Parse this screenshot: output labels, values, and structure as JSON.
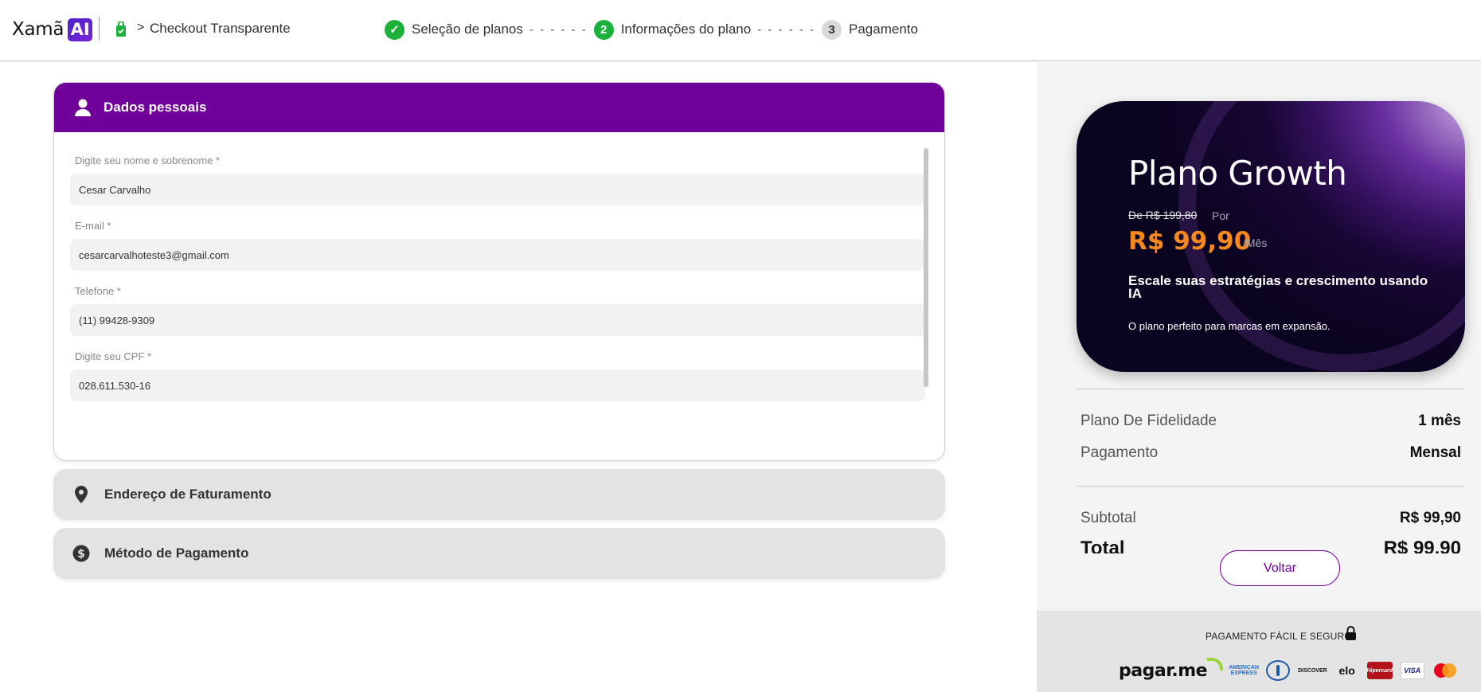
{
  "header": {
    "logo_text": "Xamã",
    "logo_badge": "AI",
    "breadcrumb_title": "Checkout Transparente",
    "steps": [
      {
        "number": "✓",
        "label": "Seleção de planos",
        "state": "done"
      },
      {
        "number": "2",
        "label": "Informações do plano",
        "state": "active"
      },
      {
        "number": "3",
        "label": "Pagamento",
        "state": "todo"
      }
    ],
    "step_separator": "- - - - - -"
  },
  "personal": {
    "title": "Dados pessoais",
    "fields": [
      {
        "label": "Digite seu nome e sobrenome *",
        "value": "Cesar Carvalho"
      },
      {
        "label": "E-mail *",
        "value": "cesarcarvalhoteste3@gmail.com"
      },
      {
        "label": "Telefone *",
        "value": "(11) 99428-9309"
      },
      {
        "label": "Digite seu CPF *",
        "value": "028.611.530-16"
      }
    ]
  },
  "billing": {
    "title": "Endereço de Faturamento"
  },
  "payment_method": {
    "title": "Método de Pagamento"
  },
  "plan": {
    "name": "Plano Growth",
    "old_price": "De R$ 199,80",
    "por": "Por",
    "price": "R$ 99,90",
    "period": "/Mês",
    "tagline": "Escale suas estratégias e crescimento usando IA",
    "description": "O plano perfeito para marcas em expansão."
  },
  "summary": {
    "fidelity_label": "Plano De Fidelidade",
    "fidelity_value": "1 mês",
    "payment_label": "Pagamento",
    "payment_value": "Mensal",
    "subtotal_label": "Subtotal",
    "subtotal_value": "R$ 99,90",
    "total_label": "Total",
    "total_value": "R$ 99,90"
  },
  "buttons": {
    "back": "Voltar"
  },
  "secure": {
    "text": "PAGAMENTO FÁCIL E SEGURO",
    "gateway": "pagar.me",
    "brands": [
      "AMERICAN EXPRESS",
      "DINERS",
      "DISCOVER",
      "elo",
      "Hipercard",
      "VISA",
      "mastercard"
    ]
  },
  "colors": {
    "primary": "#6f0099",
    "success": "#1cb13b",
    "price_orange": "#f5891e"
  }
}
